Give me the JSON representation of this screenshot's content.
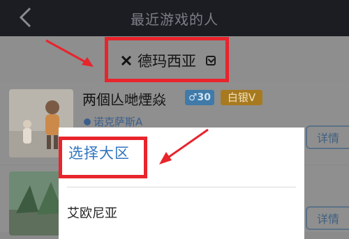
{
  "header": {
    "title": "最近游戏的人"
  },
  "filter": {
    "region": "德玛西亚"
  },
  "players": [
    {
      "name": "两個亾哋煙焱",
      "gender_badge": "♂30",
      "rank_badge": "白银V",
      "sub": "诺克萨斯A",
      "details": "详情"
    },
    {
      "details": "详情"
    }
  ],
  "region_sheet": {
    "title": "选择大区",
    "options": [
      "艾欧尼亚"
    ]
  },
  "colors": {
    "highlight": "#e8242c",
    "header_bg": "#1b1d23",
    "accent_blue": "#2f75bf",
    "rank_gold": "#a87a20",
    "gender_blue": "#3f7aa9"
  }
}
